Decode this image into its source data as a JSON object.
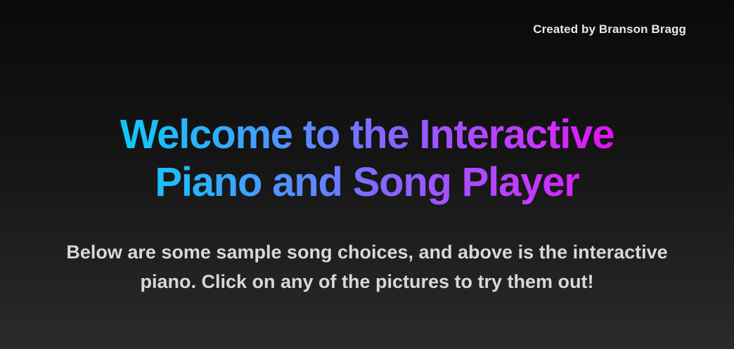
{
  "header": {
    "credit": "Created by Branson Bragg"
  },
  "hero": {
    "title": "Welcome to the Interactive Piano and Song Player",
    "subtitle": "Below are some sample song choices, and above is the interactive piano. Click on any of the pictures to try them out!"
  },
  "colors": {
    "background_top": "#0a0a0a",
    "background_bottom": "#2a2a2a",
    "gradient_start": "#00d6f5",
    "gradient_mid": "#8a62ff",
    "gradient_end": "#f000e8",
    "text": "#d8d8d8"
  }
}
